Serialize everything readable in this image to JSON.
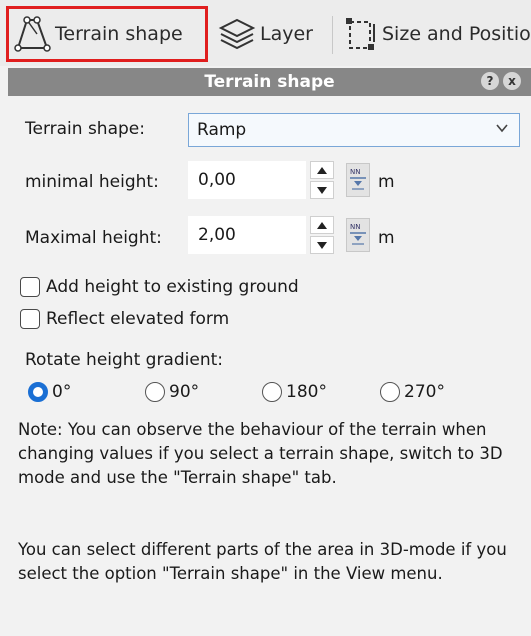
{
  "tabs": {
    "terrain_shape": "Terrain shape",
    "layer": "Layer",
    "size_position": "Size and Positio"
  },
  "panel": {
    "title": "Terrain shape",
    "help_glyph": "?",
    "close_glyph": "x"
  },
  "form": {
    "terrain_shape_label": "Terrain shape:",
    "terrain_shape_value": "Ramp",
    "min_height_label": "minimal height:",
    "min_height_value": "0,00",
    "max_height_label": "Maximal height:",
    "max_height_value": "2,00",
    "unit": "m"
  },
  "options": {
    "add_height_label": "Add height to existing ground",
    "add_height_checked": false,
    "reflect_label": "Reflect elevated form",
    "reflect_checked": false
  },
  "rotate": {
    "label": "Rotate height gradient:",
    "choices": [
      "0°",
      "90°",
      "180°",
      "270°"
    ],
    "selected": "0°"
  },
  "notes": {
    "note1": "Note: You can observe the behaviour of the terrain when changing values if you select a terrain shape, switch to 3D mode and use the \"Terrain shape\" tab.",
    "note2": "You can select different parts of the area in 3D-mode if you select the option \"Terrain shape\" in the View menu."
  },
  "colors": {
    "highlight_border": "#e01e1e",
    "panel_header": "#878787",
    "radio_selected": "#1a6fd4"
  }
}
